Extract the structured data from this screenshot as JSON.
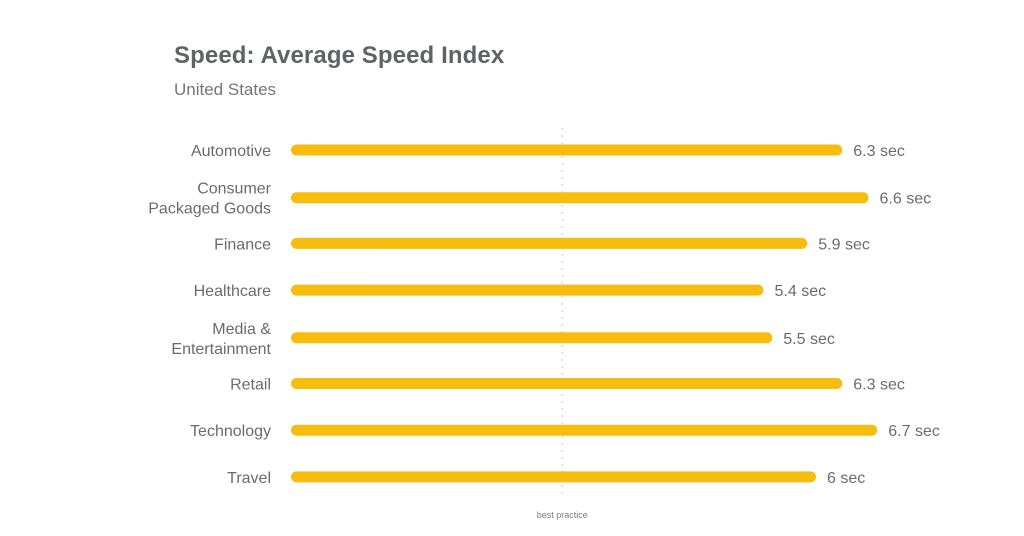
{
  "chart_data": {
    "type": "bar",
    "orientation": "horizontal",
    "title": "Speed: Average Speed Index",
    "subtitle": "United States",
    "categories": [
      [
        "Automotive"
      ],
      [
        "Consumer",
        "Packaged Goods"
      ],
      [
        "Finance"
      ],
      [
        "Healthcare"
      ],
      [
        "Media &",
        "Entertainment"
      ],
      [
        "Retail"
      ],
      [
        "Technology"
      ],
      [
        "Travel"
      ]
    ],
    "values": [
      6.3,
      6.6,
      5.9,
      5.4,
      5.5,
      6.3,
      6.7,
      6.0
    ],
    "value_labels": [
      "6.3 sec",
      "6.6 sec",
      "5.9 sec",
      "5.4 sec",
      "5.5 sec",
      "6.3 sec",
      "6.7 sec",
      "6 sec"
    ],
    "unit": "sec",
    "reference_line": {
      "label": "best practice",
      "value": 3.1
    },
    "xlabel": "",
    "ylabel": "",
    "xlim": [
      0,
      6.7
    ],
    "grid": false,
    "legend": "none",
    "bar_color": "#F6BD0F"
  }
}
